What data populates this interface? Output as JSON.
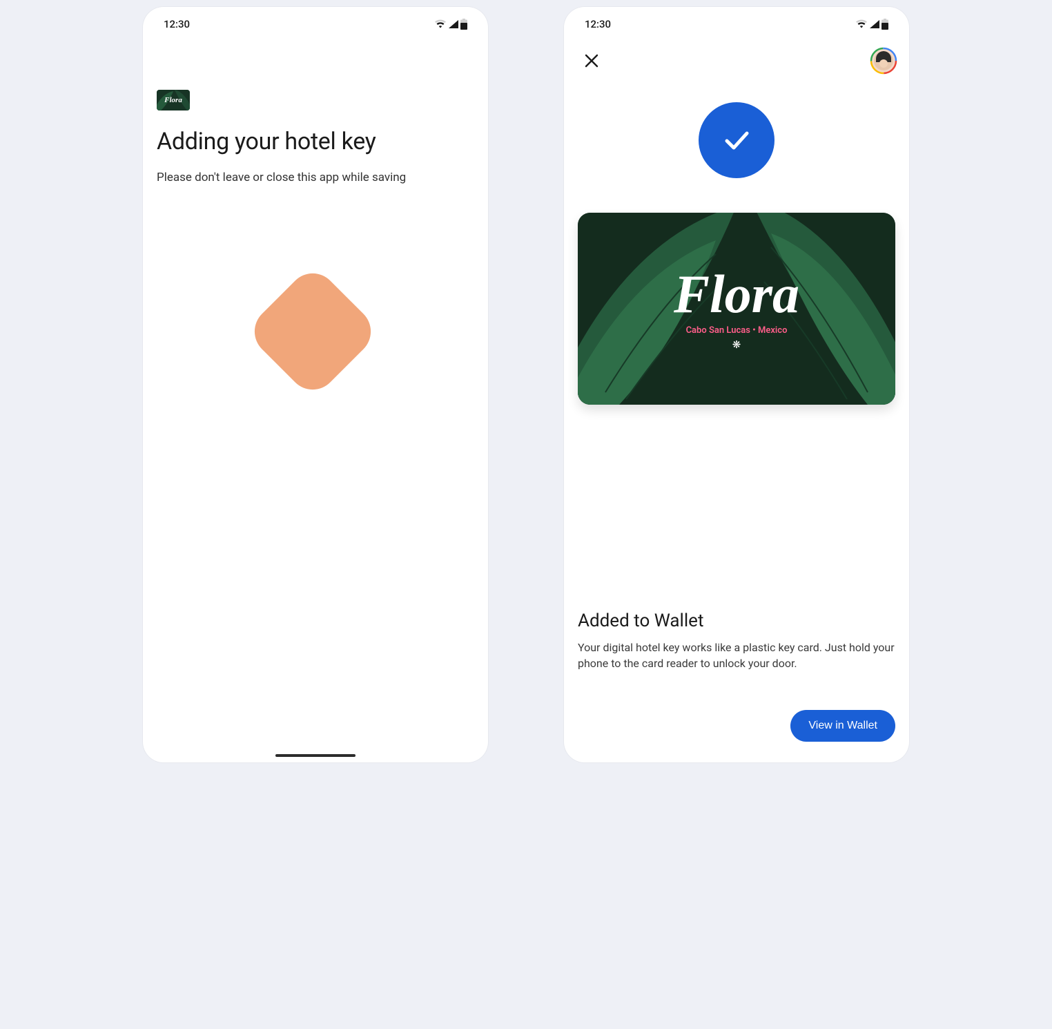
{
  "status": {
    "time": "12:30"
  },
  "left": {
    "mini_card_brand": "Flora",
    "heading": "Adding your hotel key",
    "subtext": "Please don't leave or close this app while saving"
  },
  "right": {
    "card": {
      "brand": "Flora",
      "location": "Cabo San Lucas  •  Mexico",
      "snowflake": "❋"
    },
    "added_title": "Added to Wallet",
    "added_desc": "Your digital hotel key works like a plastic key card. Just hold your phone to the card reader to unlock your door.",
    "button": "View in Wallet"
  }
}
